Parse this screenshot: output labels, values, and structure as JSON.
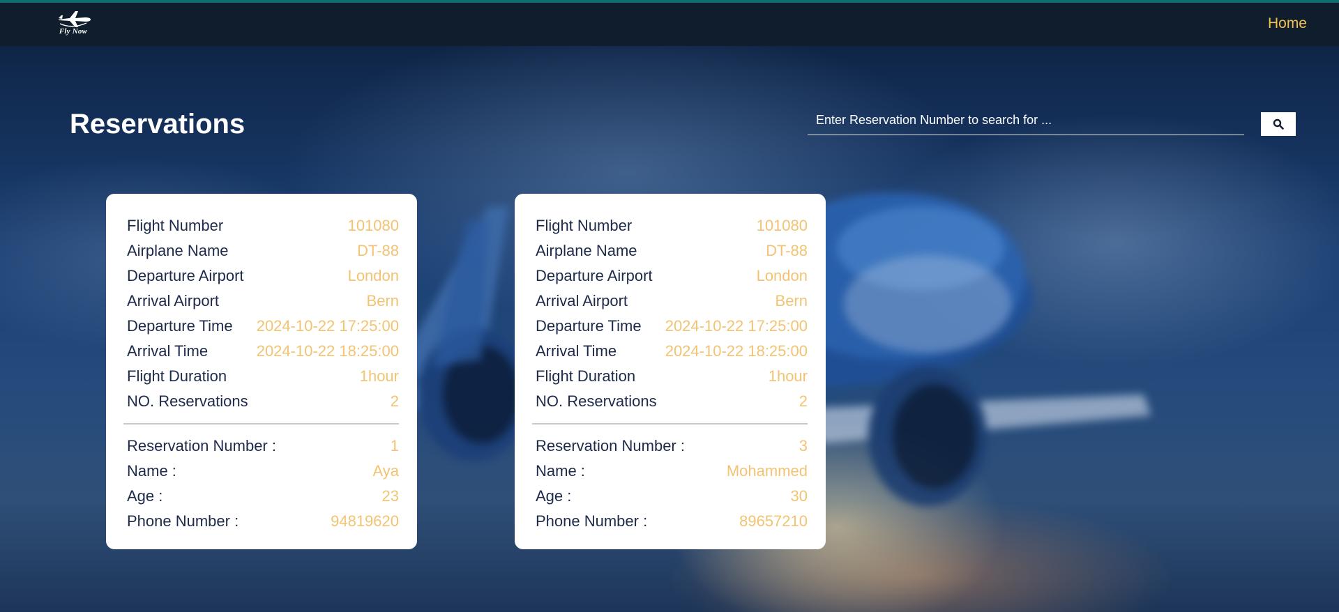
{
  "navbar": {
    "logo_text": "Fly Now",
    "home_label": "Home"
  },
  "page": {
    "title": "Reservations"
  },
  "search": {
    "placeholder": "Enter Reservation Number to search for ...",
    "value": ""
  },
  "colors": {
    "accent": "#f2c14e",
    "value_text": "#f2c372",
    "label_text": "#1d2a4a",
    "navbar_bg": "#0f1d2c",
    "accent_strip": "#0f6e72"
  },
  "cards": [
    {
      "flight": [
        {
          "label": "Flight Number",
          "value": "101080"
        },
        {
          "label": "Airplane Name",
          "value": "DT-88"
        },
        {
          "label": "Departure Airport",
          "value": "London"
        },
        {
          "label": "Arrival Airport",
          "value": "Bern"
        },
        {
          "label": "Departure Time",
          "value": "2024-10-22 17:25:00"
        },
        {
          "label": "Arrival Time",
          "value": "2024-10-22 18:25:00"
        },
        {
          "label": "Flight Duration",
          "value": "1hour"
        },
        {
          "label": "NO. Reservations",
          "value": "2"
        }
      ],
      "reservation": [
        {
          "label": "Reservation Number :",
          "value": "1"
        },
        {
          "label": "Name :",
          "value": "Aya"
        },
        {
          "label": "Age :",
          "value": "23"
        },
        {
          "label": "Phone Number :",
          "value": "94819620"
        }
      ]
    },
    {
      "flight": [
        {
          "label": "Flight Number",
          "value": "101080"
        },
        {
          "label": "Airplane Name",
          "value": "DT-88"
        },
        {
          "label": "Departure Airport",
          "value": "London"
        },
        {
          "label": "Arrival Airport",
          "value": "Bern"
        },
        {
          "label": "Departure Time",
          "value": "2024-10-22 17:25:00"
        },
        {
          "label": "Arrival Time",
          "value": "2024-10-22 18:25:00"
        },
        {
          "label": "Flight Duration",
          "value": "1hour"
        },
        {
          "label": "NO. Reservations",
          "value": "2"
        }
      ],
      "reservation": [
        {
          "label": "Reservation Number :",
          "value": "3"
        },
        {
          "label": "Name :",
          "value": "Mohammed"
        },
        {
          "label": "Age :",
          "value": "30"
        },
        {
          "label": "Phone Number :",
          "value": "89657210"
        }
      ]
    }
  ]
}
